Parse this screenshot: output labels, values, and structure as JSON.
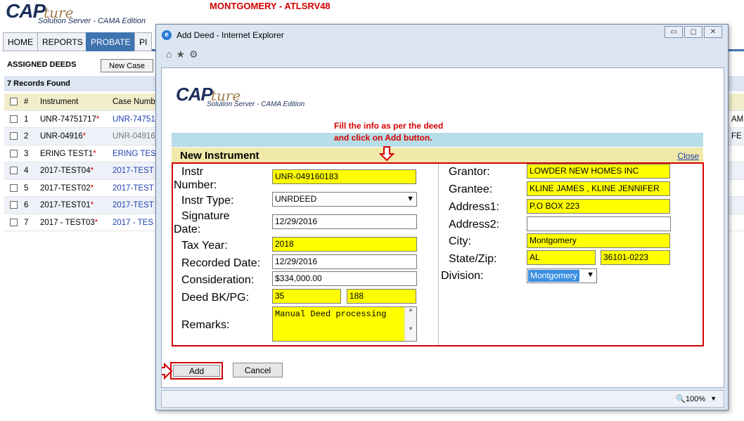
{
  "app": {
    "logo_main": "CAP",
    "logo_script": "ture",
    "logo_tagline": "Solution Server - CAMA Edition",
    "server_title": "MONTGOMERY - ATLSRV48"
  },
  "nav": {
    "tabs": [
      {
        "label": "HOME"
      },
      {
        "label": "REPORTS"
      },
      {
        "label": "PROBATE"
      },
      {
        "label": "PI"
      }
    ]
  },
  "deeds": {
    "header": "ASSIGNED DEEDS",
    "new_case_label": "New Case",
    "records_found": "7 Records Found",
    "columns": {
      "num": "#",
      "instrument": "Instrument",
      "case": "Case Numb"
    },
    "rows": [
      {
        "num": "1",
        "instrument": "UNR-74751717",
        "case": "UNR-74751",
        "far": "AM"
      },
      {
        "num": "2",
        "instrument": "UNR-04916",
        "case": "UNR-04916",
        "far": "FE"
      },
      {
        "num": "3",
        "instrument": "ERING TEST1",
        "case": "ERING TES",
        "far": ""
      },
      {
        "num": "4",
        "instrument": "2017-TEST04",
        "case": "2017-TEST",
        "far": ""
      },
      {
        "num": "5",
        "instrument": "2017-TEST02",
        "case": "2017-TEST",
        "far": ""
      },
      {
        "num": "6",
        "instrument": "2017-TEST01",
        "case": "2017-TEST",
        "far": ""
      },
      {
        "num": "7",
        "instrument": "2017 - TEST03",
        "case": "2017 - TES",
        "far": ""
      }
    ]
  },
  "dialog": {
    "window_title": "Add Deed - Internet Explorer",
    "zoom": "100%",
    "annotation_line1": "Fill the info as per the deed",
    "annotation_line2": "and click on Add button.",
    "section_title": "New Instrument",
    "close_label": "Close",
    "add_label": "Add",
    "cancel_label": "Cancel",
    "left": {
      "instr_number_label_1": "Instr",
      "instr_number_label_2": "Number:",
      "instr_number": "UNR-049160183",
      "instr_type_label": "Instr Type:",
      "instr_type": "UNRDEED",
      "signature_label_1": "Signature",
      "signature_label_2": "Date:",
      "signature_date": "12/29/2016",
      "tax_year_label": "Tax Year:",
      "tax_year": "2018",
      "recorded_date_label": "Recorded Date:",
      "recorded_date": "12/29/2016",
      "consideration_label": "Consideration:",
      "consideration": "$334,000.00",
      "deed_bkpg_label": "Deed BK/PG:",
      "deed_bk": "35",
      "deed_pg": "188",
      "remarks_label": "Remarks:",
      "remarks": "Manual Deed processing"
    },
    "right": {
      "grantor_label": "Grantor:",
      "grantor": "LOWDER NEW HOMES INC",
      "grantee_label": "Grantee:",
      "grantee": "KLINE JAMES , KLINE JENNIFER",
      "address1_label": "Address1:",
      "address1": "P.O BOX 223",
      "address2_label": "Address2:",
      "address2": "",
      "city_label": "City:",
      "city": "Montgomery",
      "statezip_label": "State/Zip:",
      "state": "AL",
      "zip": "36101-0223",
      "division_label": "Division:",
      "division": "Montgomery"
    }
  },
  "colors": {
    "accent_blue": "#3f74b0",
    "highlight_yellow": "#ffff00",
    "annotation_red": "#d40000",
    "section_bar": "#f0e9a9"
  }
}
